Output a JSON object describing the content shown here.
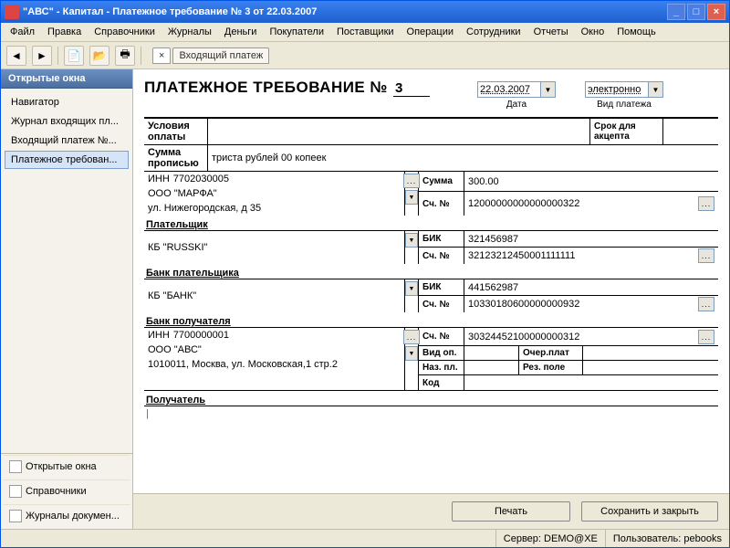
{
  "window": {
    "title": "\"АВС\" - Капитал - Платежное требование № 3 от 22.03.2007"
  },
  "menu": [
    "Файл",
    "Правка",
    "Справочники",
    "Журналы",
    "Деньги",
    "Покупатели",
    "Поставщики",
    "Операции",
    "Сотрудники",
    "Отчеты",
    "Окно",
    "Помощь"
  ],
  "tab": {
    "label": "Входящий платеж"
  },
  "sidebar": {
    "header": "Открытые окна",
    "items": [
      "Навигатор",
      "Журнал входящих пл...",
      "Входящий платеж №...",
      "Платежное требован..."
    ],
    "bottom": [
      "Открытые окна",
      "Справочники",
      "Журналы докумен..."
    ]
  },
  "doc": {
    "title": "ПЛАТЕЖНОЕ ТРЕБОВАНИЕ №",
    "number": "3",
    "date": "22.03.2007",
    "date_label": "Дата",
    "pay_kind": "электронно",
    "pay_kind_label": "Вид платежа",
    "usl_label": "Условия оплаты",
    "srok_label": "Срок для акцепта",
    "sumprop_label": "Сумма прописью",
    "sumprop_value": "триста рублей 00 копеек",
    "payer_inn_label": "ИНН",
    "payer_inn": "7702030005",
    "payer_name": "ООО \"МАРФА\"",
    "payer_addr": "ул. Нижегородская, д 35",
    "summa_label": "Сумма",
    "summa_value": "300.00",
    "sch_label": "Сч. №",
    "payer_sch": "12000000000000000322",
    "section_payer": "Плательщик",
    "payer_bank": "КБ \"RUSSKI\"",
    "bik_label": "БИК",
    "payer_bik": "321456987",
    "payer_bank_sch": "32123212450001111111",
    "section_payer_bank": "Банк плательщика",
    "recv_bank": "КБ \"БАНК\"",
    "recv_bik": "441562987",
    "recv_bank_sch": "10330180600000000932",
    "section_recv_bank": "Банк получателя",
    "recv_inn": "7700000001",
    "recv_name": "ООО \"АВС\"",
    "recv_addr": "1010011, Москва, ул. Московская,1 стр.2",
    "recv_sch": "30324452100000000312",
    "vid_op_label": "Вид оп.",
    "naz_pl_label": "Наз. пл.",
    "kod_label": "Код",
    "ocher_label": "Очер.плат",
    "rez_label": "Рез. поле",
    "section_recv": "Получатель"
  },
  "buttons": {
    "print": "Печать",
    "save": "Сохранить и закрыть"
  },
  "status": {
    "server_label": "Сервер:",
    "server": "DEMO@XE",
    "user_label": "Пользователь:",
    "user": "pebooks"
  }
}
